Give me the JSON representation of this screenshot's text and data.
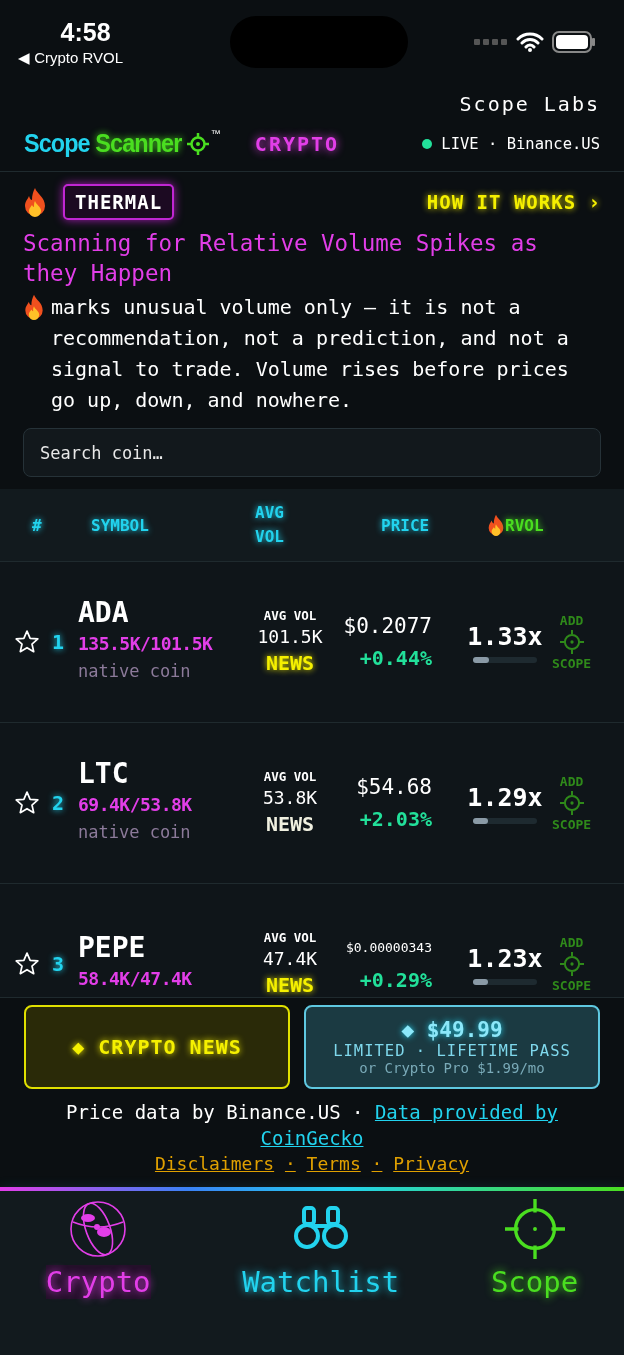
{
  "status_bar": {
    "time": "4:58",
    "back": "◀ Crypto RVOL"
  },
  "header": {
    "company": "Scope Labs",
    "brand_first": "Scope",
    "brand_second": "Scanner",
    "trademark": "™",
    "market": "CRYPTO",
    "live": "LIVE · Binance.US"
  },
  "intro": {
    "badge": "THERMAL",
    "how_it_works": "HOW IT WORKS ›",
    "tagline": "Scanning for Relative Volume Spikes as they Happen",
    "disclaimer": "marks unusual volume only — it is not a recommendation, not a prediction, and not a signal to trade. Volume rises before prices go up, down, and nowhere."
  },
  "search": {
    "placeholder": "Search coin…"
  },
  "table": {
    "columns": [
      {
        "label": "#",
        "color": "#22d3ee",
        "flame": false
      },
      {
        "label": "SYMBOL",
        "color": "#22d3ee",
        "flame": false
      },
      {
        "label": "AVG VOL",
        "color": "#22d3ee",
        "flame": false
      },
      {
        "label": "PRICE",
        "color": "#22d3ee",
        "flame": false
      },
      {
        "label": "RVOL",
        "color": "#4ade20",
        "flame": true
      }
    ],
    "rows": [
      {
        "starred": false,
        "rank": "1",
        "symbol": "ADA",
        "volumes": "135.5K/101.5K",
        "note": "native coin",
        "avg_label": "AVG VOL",
        "avg": "101.5K",
        "news": "NEWS",
        "news_hot": true,
        "price": "$0.2077",
        "change": "+0.44%",
        "rvol": "1.33x",
        "level": 0.25,
        "add": "ADD",
        "scope": "SCOPE"
      },
      {
        "starred": false,
        "rank": "2",
        "symbol": "LTC",
        "volumes": "69.4K/53.8K",
        "note": "native coin",
        "avg_label": "AVG VOL",
        "avg": "53.8K",
        "news": "NEWS",
        "news_hot": false,
        "price": "$54.68",
        "change": "+2.03%",
        "rvol": "1.29x",
        "level": 0.24,
        "add": "ADD",
        "scope": "SCOPE"
      },
      {
        "starred": false,
        "rank": "3",
        "symbol": "PEPE",
        "volumes": "58.4K/47.4K",
        "avg_label": "AVG VOL",
        "avg": "47.4K",
        "news": "NEWS",
        "news_hot": true,
        "price": "$0.00000343",
        "change": "+0.29%",
        "rvol": "1.23x",
        "level": 0.23,
        "add": "ADD",
        "scope": "SCOPE"
      }
    ]
  },
  "promo": {
    "news_button": "◆ CRYPTO NEWS",
    "price": "◆ $49.99",
    "offer": "LIMITED · LIFETIME PASS",
    "alt": "or Crypto Pro $1.99/mo"
  },
  "footer": {
    "source": "Price data by Binance.US ·",
    "gecko_link": [
      "Data provided by",
      "CoinGecko"
    ],
    "links": [
      "Disclaimers",
      "Terms",
      "Privacy"
    ],
    "separator": "·"
  },
  "tabs": [
    {
      "label": "Crypto",
      "selected": true,
      "color": "#e23ee8",
      "kind": "globe"
    },
    {
      "label": "Watchlist",
      "selected": false,
      "color": "#22d3ee",
      "kind": "binoculars"
    },
    {
      "label": "Scope",
      "selected": false,
      "color": "#4ade20",
      "kind": "crosshair"
    }
  ]
}
